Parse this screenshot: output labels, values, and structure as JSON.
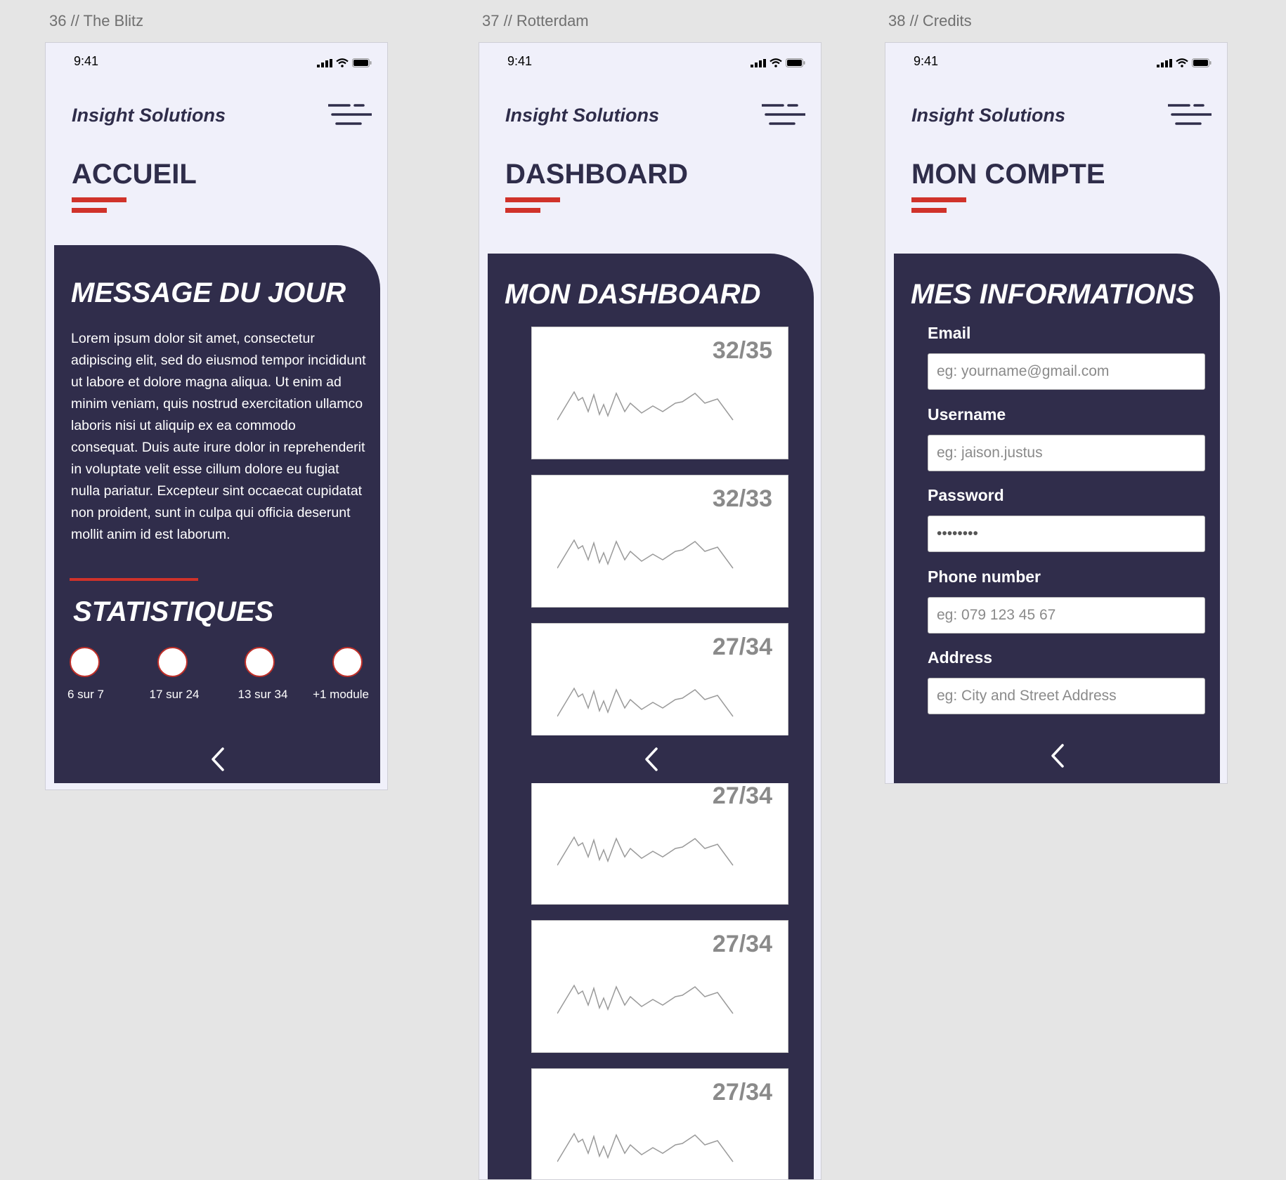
{
  "artboards": [
    {
      "label": "36 // The Blitz"
    },
    {
      "label": "37 // Rotterdam"
    },
    {
      "label": "38 // Credits"
    }
  ],
  "status_bar": {
    "time": "9:41"
  },
  "brand": "Insight Solutions",
  "accueil": {
    "title": "ACCUEIL",
    "message_title": "MESSAGE DU JOUR",
    "message_body": "Lorem ipsum dolor sit amet, consectetur adipiscing elit, sed do eiusmod tempor incididunt ut labore et dolore magna aliqua. Ut enim ad minim veniam, quis nostrud exercitation ullamco laboris nisi ut aliquip ex ea commodo consequat. Duis aute irure dolor in reprehenderit in voluptate velit esse cillum dolore eu fugiat nulla pariatur. Excepteur sint occaecat cupidatat non proident, sunt in culpa qui officia deserunt mollit anim id est laborum.",
    "stats_title": "STATISTIQUES",
    "stats": [
      {
        "label": "6 sur 7"
      },
      {
        "label": "17 sur 24"
      },
      {
        "label": "13 sur 34"
      },
      {
        "label": "+1 module"
      }
    ]
  },
  "dashboard": {
    "title": "DASHBOARD",
    "panel_title": "MON DASHBOARD",
    "cards": [
      {
        "value": "32/35"
      },
      {
        "value": "32/33"
      },
      {
        "value": "27/34"
      },
      {
        "value": "27/34"
      },
      {
        "value": "27/34"
      },
      {
        "value": "27/34"
      }
    ]
  },
  "compte": {
    "title": "MON COMPTE",
    "panel_title": "MES INFORMATIONS",
    "fields": [
      {
        "label": "Email",
        "placeholder": "eg: yourname@gmail.com",
        "value": ""
      },
      {
        "label": "Username",
        "placeholder": "eg: jaison.justus",
        "value": ""
      },
      {
        "label": "Password",
        "placeholder": "",
        "value": "••••••••"
      },
      {
        "label": "Phone number",
        "placeholder": "eg: 079 123 45 67",
        "value": ""
      },
      {
        "label": "Address",
        "placeholder": "eg: City and Street Address",
        "value": ""
      }
    ]
  },
  "colors": {
    "panel": "#302d4b",
    "accent": "#d0322a",
    "phone_bg": "#f0f0fa",
    "canvas": "#e5e5e5"
  },
  "icons": {
    "menu": "menu-lines-icon",
    "back": "chevron-left-icon",
    "signal": "signal-icon",
    "wifi": "wifi-icon",
    "battery": "battery-icon"
  }
}
